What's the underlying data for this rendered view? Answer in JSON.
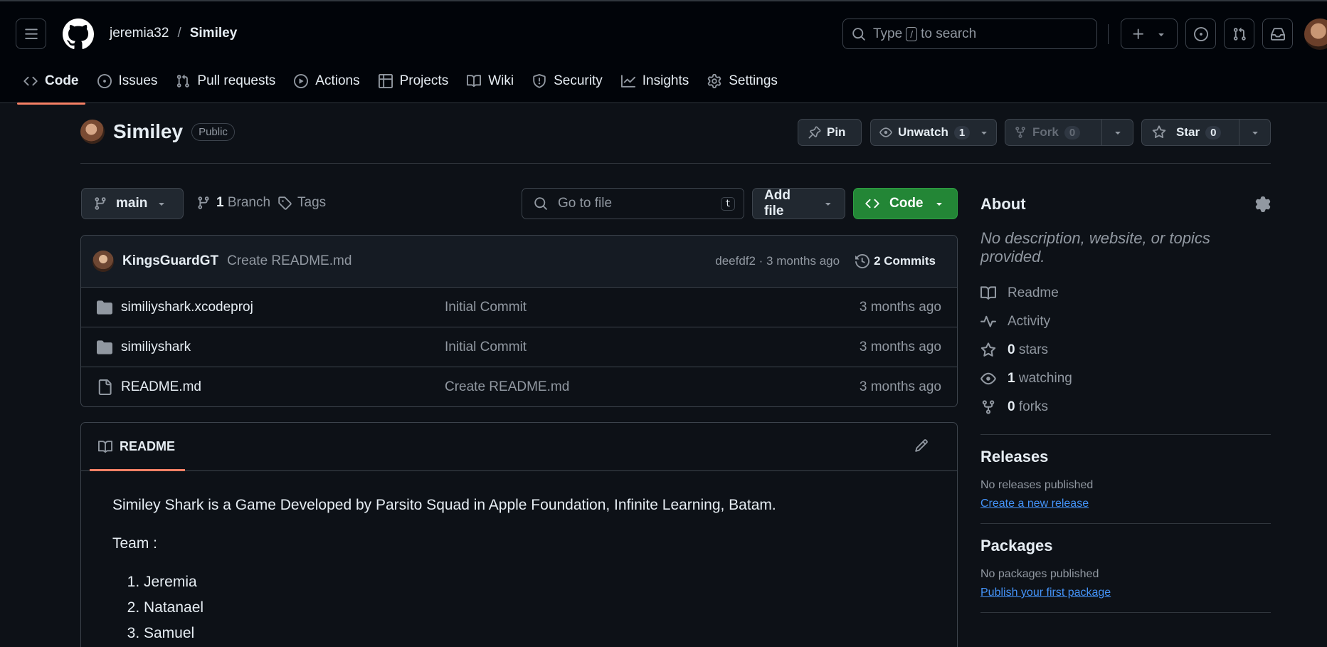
{
  "header": {
    "owner": "jeremia32",
    "separator": "/",
    "repo": "Similey",
    "search": {
      "prefix": "Type",
      "key": "/",
      "suffix": "to search"
    }
  },
  "nav": {
    "code": "Code",
    "issues": "Issues",
    "pull_requests": "Pull requests",
    "actions": "Actions",
    "projects": "Projects",
    "wiki": "Wiki",
    "security": "Security",
    "insights": "Insights",
    "settings": "Settings"
  },
  "repo": {
    "name": "Similey",
    "visibility": "Public",
    "pin": "Pin",
    "unwatch": "Unwatch",
    "watch_count": "1",
    "fork": "Fork",
    "fork_count": "0",
    "star": "Star",
    "star_count": "0"
  },
  "toolbar": {
    "branch": "main",
    "branch_count": "1",
    "branch_label": "Branch",
    "tags": "Tags",
    "goto_placeholder": "Go to file",
    "goto_key": "t",
    "add_file": "Add file",
    "code": "Code"
  },
  "commit": {
    "author": "KingsGuardGT",
    "message": "Create README.md",
    "sha_time": "deefdf2 · 3 months ago",
    "commits_label": "2 Commits"
  },
  "files": [
    {
      "name": "similiyshark.xcodeproj",
      "message": "Initial Commit",
      "date": "3 months ago",
      "type": "folder"
    },
    {
      "name": "similiyshark",
      "message": "Initial Commit",
      "date": "3 months ago",
      "type": "folder"
    },
    {
      "name": "README.md",
      "message": "Create README.md",
      "date": "3 months ago",
      "type": "file"
    }
  ],
  "readme": {
    "tab": "README",
    "intro": "Similey Shark is a Game Developed by Parsito Squad in Apple Foundation, Infinite Learning, Batam.",
    "team_label": "Team :",
    "team": [
      "Jeremia",
      "Natanael",
      "Samuel"
    ]
  },
  "about": {
    "title": "About",
    "description": "No description, website, or topics provided.",
    "readme": "Readme",
    "activity": "Activity",
    "stars_count": "0",
    "stars_label": "stars",
    "watching_count": "1",
    "watching_label": "watching",
    "forks_count": "0",
    "forks_label": "forks"
  },
  "releases": {
    "title": "Releases",
    "empty": "No releases published",
    "link": "Create a new release"
  },
  "packages": {
    "title": "Packages",
    "empty": "No packages published",
    "link": "Publish your first package"
  }
}
